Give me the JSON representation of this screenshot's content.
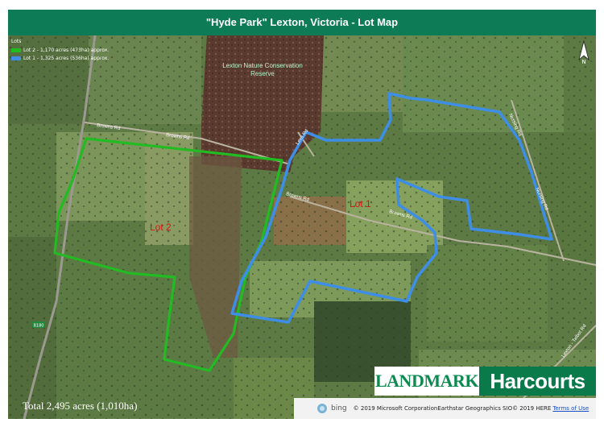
{
  "title": "\"Hyde Park\" Lexton, Victoria - Lot Map",
  "legend": {
    "title": "Lots",
    "items": [
      {
        "label": "Lot 2 - 1,170 acres (473ha) approx.",
        "color": "#22bb22"
      },
      {
        "label": "Lot 1 - 1,325 acres (536ha) approx.",
        "color": "#3e8ee6"
      }
    ]
  },
  "compass": {
    "label": "N"
  },
  "map_labels": {
    "reserve_line1": "Lexton Nature Conservation",
    "reserve_line2": "Reserve",
    "lot1": "Lot 1",
    "lot2": "Lot 2",
    "roads": {
      "browns_rd_1": "Browns Rd",
      "browns_rd_2": "Browns Rd",
      "browns_rd_3": "Browns Rd",
      "browns_rd_4": "Browns Rd",
      "lexs_rd": "Lexs Rd",
      "nursing_rd": "Nursing Rd",
      "lexton_talbot_rd": "Lexton - Talbot Rd",
      "highway_shield": "B180"
    }
  },
  "total_text": "Total 2,495 acres (1,010ha)",
  "logos": {
    "landmark": "LANDMARK",
    "harcourts": "Harcourts"
  },
  "attribution": {
    "bing": "bing",
    "copyright": "© 2019 Microsoft CorporationEarthstar Geographics SIO© 2019 HERE",
    "terms": "Terms of Use"
  },
  "colors": {
    "title_bar": "#0e7b57",
    "lot1_boundary": "#3e8ee6",
    "lot2_boundary": "#22bb22",
    "lot_label": "#dd1111",
    "reserve": "#5a3a2e"
  }
}
